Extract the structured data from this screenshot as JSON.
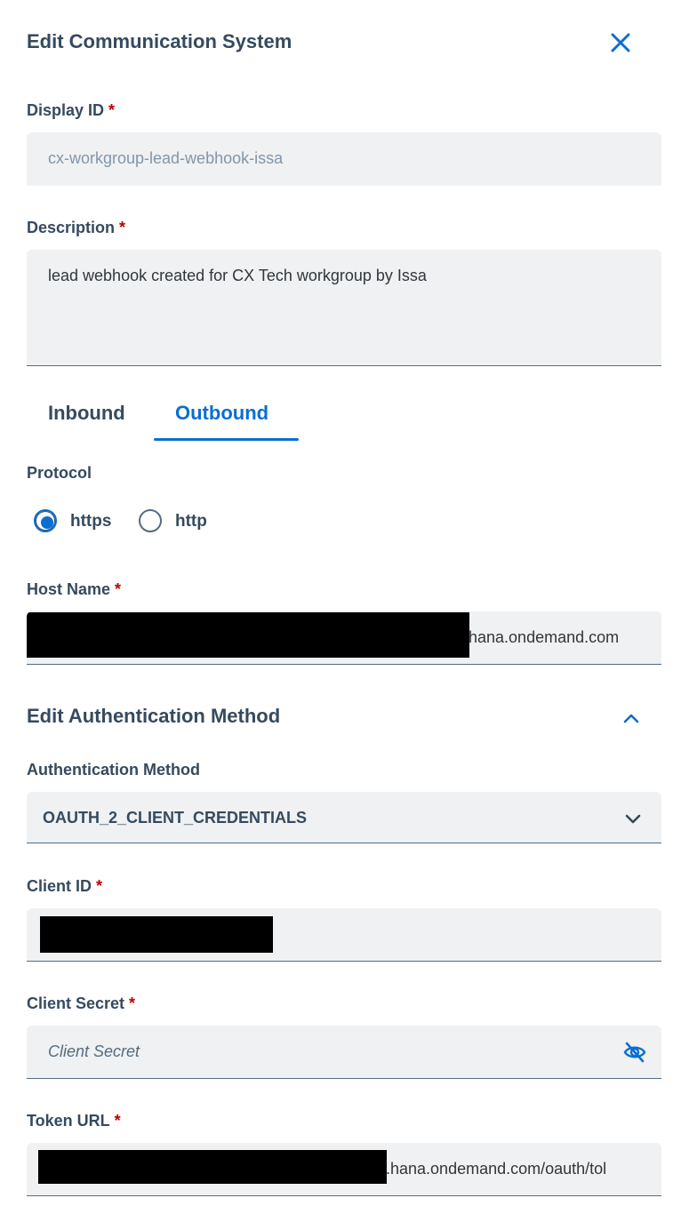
{
  "dialog": {
    "title": "Edit Communication System",
    "close_icon": "close-icon"
  },
  "required_marker": "*",
  "display_id": {
    "label": "Display ID",
    "value": "cx-workgroup-lead-webhook-issa"
  },
  "description": {
    "label": "Description",
    "value": "lead webhook created for CX Tech workgroup by Issa"
  },
  "tabs": [
    {
      "label": "Inbound",
      "active": false
    },
    {
      "label": "Outbound",
      "active": true
    }
  ],
  "protocol": {
    "label": "Protocol",
    "options": [
      {
        "label": "https",
        "selected": true
      },
      {
        "label": "http",
        "selected": false
      }
    ]
  },
  "host_name": {
    "label": "Host Name",
    "visible_value": "hana.ondemand.com"
  },
  "auth_section": {
    "title": "Edit Authentication Method",
    "expanded": true
  },
  "auth_method": {
    "label": "Authentication Method",
    "value": "OAUTH_2_CLIENT_CREDENTIALS"
  },
  "client_id": {
    "label": "Client ID"
  },
  "client_secret": {
    "label": "Client Secret",
    "placeholder": "Client Secret"
  },
  "token_url": {
    "label": "Token URL",
    "visible_value": ".hana.ondemand.com/oauth/tol"
  },
  "colors": {
    "accent": "#0a6ed1",
    "label": "#354a5f",
    "required": "#bb0000",
    "field_bg": "#eff1f2"
  }
}
